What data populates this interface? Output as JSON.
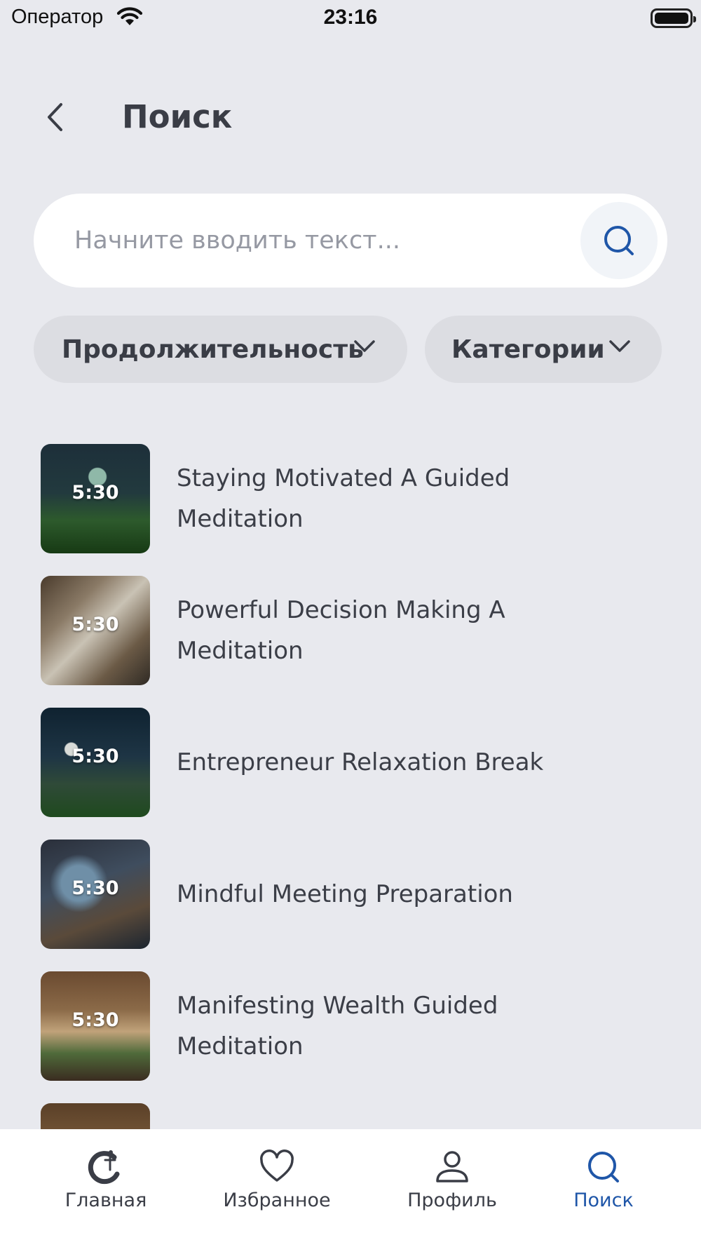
{
  "status_bar": {
    "carrier": "Оператор",
    "time": "23:16"
  },
  "header": {
    "title": "Поиск"
  },
  "search": {
    "placeholder": "Начните вводить текст...",
    "value": ""
  },
  "filters": {
    "duration_label": "Продолжительность",
    "category_label": "Категории"
  },
  "results": [
    {
      "duration": "5:30",
      "title": "Staying Motivated A Guided Meditation"
    },
    {
      "duration": "5:30",
      "title": "Powerful Decision Making A Meditation"
    },
    {
      "duration": "5:30",
      "title": "Entrepreneur Relaxation Break"
    },
    {
      "duration": "5:30",
      "title": "Mindful Meeting Preparation"
    },
    {
      "duration": "5:30",
      "title": "Manifesting Wealth Guided Meditation"
    }
  ],
  "tab_bar": {
    "items": [
      {
        "label": "Главная",
        "icon": "home-logo-icon"
      },
      {
        "label": "Избранное",
        "icon": "heart-icon"
      },
      {
        "label": "Профиль",
        "icon": "person-icon"
      },
      {
        "label": "Поиск",
        "icon": "search-icon"
      }
    ],
    "active_index": 3,
    "active_color": "#1f56a8"
  },
  "colors": {
    "background": "#e8e9ee",
    "accent": "#1f56a8",
    "text": "#3b3e47"
  }
}
